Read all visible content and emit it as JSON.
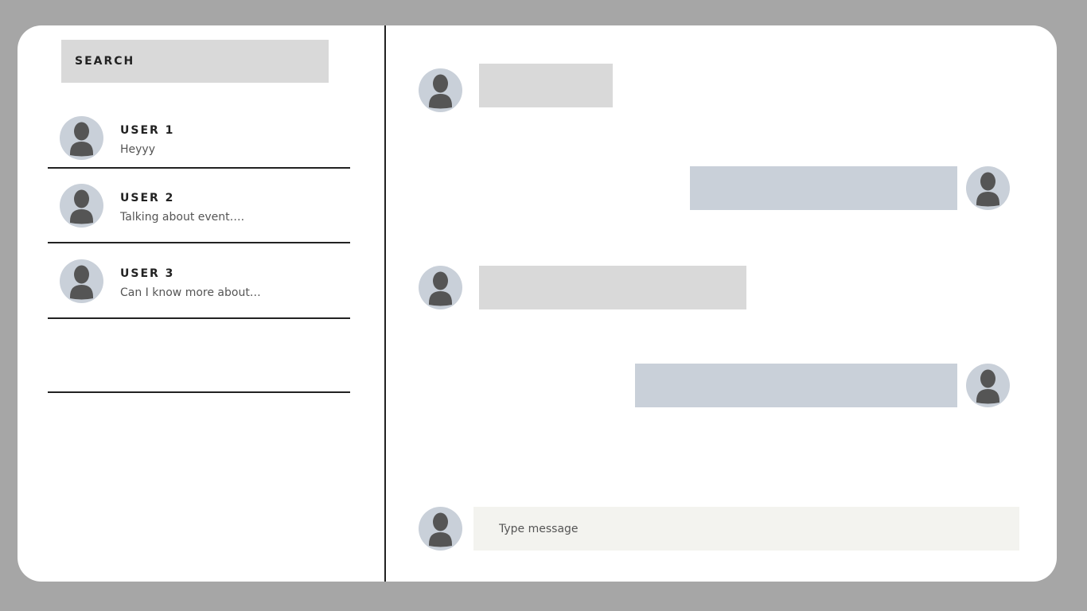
{
  "search": {
    "label": "SEARCH"
  },
  "conversations": [
    {
      "name": "USER 1",
      "preview": "Heyyy"
    },
    {
      "name": "USER 2",
      "preview": "Talking about event…."
    },
    {
      "name": "USER 3",
      "preview": "Can I know more about…"
    }
  ],
  "composer": {
    "placeholder": "Type message"
  },
  "colors": {
    "background": "#a6a6a6",
    "panel": "#ffffff",
    "incoming_bubble": "#d9d9d9",
    "outgoing_bubble": "#c9d0d9",
    "avatar_bg": "#c9d0d9",
    "avatar_figure": "#555555",
    "composer_bg": "#f3f3ef"
  },
  "icons": {
    "avatar": "user-avatar-icon"
  }
}
